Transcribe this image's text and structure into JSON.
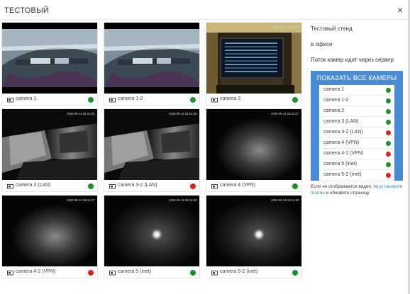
{
  "modal": {
    "title": "ТЕСТОВЫЙ",
    "close_symbol": "×"
  },
  "cameras": [
    {
      "label": "camera 1",
      "status": "online",
      "scene": "dashboard",
      "timestamp": ""
    },
    {
      "label": "camera 1-2",
      "status": "online",
      "scene": "dashboard",
      "timestamp": ""
    },
    {
      "label": "camera 2",
      "status": "online",
      "scene": "monitor",
      "timestamp": "2020-09-14 18:41:27"
    },
    {
      "label": "camera 3 (LAN)",
      "status": "online",
      "scene": "corridor",
      "timestamp": "2020-09-14 18:41:29"
    },
    {
      "label": "camera 3-2 (LAN)",
      "status": "offline",
      "scene": "corridor",
      "timestamp": "2020-09-14 18:41:28"
    },
    {
      "label": "camera 4 (VPN)",
      "status": "online",
      "scene": "glow",
      "timestamp": "2020-09-14 18:41:27"
    },
    {
      "label": "camera 4-2 (VPN)",
      "status": "offline",
      "scene": "glow",
      "timestamp": "2020-09-14 18:41:27"
    },
    {
      "label": "camera 5 (inet)",
      "status": "online",
      "scene": "spot",
      "timestamp": "2020-09-14 18:41:28"
    },
    {
      "label": "camera 5-2 (inet)",
      "status": "online",
      "scene": "spot",
      "timestamp": "2020-09-14 18:41:28"
    }
  ],
  "info": {
    "line1": "Тестовый стенд",
    "line2": "в офисе",
    "line3": "Поток камер идет через сервер"
  },
  "show_all": {
    "button_label": "ПОКАЗАТЬ ВСЕ КАМЕРЫ",
    "items": [
      {
        "label": "camera 1",
        "status": "online"
      },
      {
        "label": "camera 1-2",
        "status": "online"
      },
      {
        "label": "camera 2",
        "status": "online"
      },
      {
        "label": "camera 3 (LAN)",
        "status": "online"
      },
      {
        "label": "camera 3-2 (LAN)",
        "status": "offline"
      },
      {
        "label": "camera 4 (VPN)",
        "status": "online"
      },
      {
        "label": "camera 4-2 (VPN)",
        "status": "offline"
      },
      {
        "label": "camera 5 (inet)",
        "status": "online"
      },
      {
        "label": "camera 5-2 (inet)",
        "status": "offline"
      }
    ]
  },
  "notice": {
    "text_before": "Если не отображается видео, то ",
    "link_text": "установите плагин",
    "text_after": " и обновите страницу"
  },
  "colors": {
    "online": "#1f8f2c",
    "offline": "#d9251d",
    "accent": "#4a8bd1",
    "link": "#2f80d0"
  }
}
